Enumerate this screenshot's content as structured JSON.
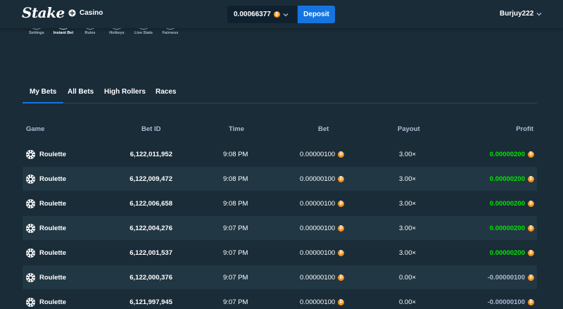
{
  "header": {
    "logo": "Stake",
    "casino_label": "Casino",
    "balance": "0.00066377",
    "deposit_label": "Deposit",
    "username": "Burjuy222"
  },
  "controls": [
    {
      "label": "Settings",
      "active": false
    },
    {
      "label": "Instant Bet",
      "active": true
    },
    {
      "label": "Rules",
      "active": false
    },
    {
      "label": "Hotkeys",
      "active": false
    },
    {
      "label": "Live Stats",
      "active": false
    },
    {
      "label": "Fairness",
      "active": false
    }
  ],
  "tabs": [
    "My Bets",
    "All Bets",
    "High Rollers",
    "Races"
  ],
  "table": {
    "columns": [
      "Game",
      "Bet ID",
      "Time",
      "Bet",
      "Payout",
      "Profit"
    ],
    "rows": [
      {
        "game": "Roulette",
        "bet_id": "6,122,011,952",
        "time": "9:08 PM",
        "bet": "0.00000100",
        "payout": "3.00×",
        "profit": "0.00000200",
        "positive": true
      },
      {
        "game": "Roulette",
        "bet_id": "6,122,009,472",
        "time": "9:08 PM",
        "bet": "0.00000100",
        "payout": "3.00×",
        "profit": "0.00000200",
        "positive": true
      },
      {
        "game": "Roulette",
        "bet_id": "6,122,006,658",
        "time": "9:08 PM",
        "bet": "0.00000100",
        "payout": "3.00×",
        "profit": "0.00000200",
        "positive": true
      },
      {
        "game": "Roulette",
        "bet_id": "6,122,004,276",
        "time": "9:07 PM",
        "bet": "0.00000100",
        "payout": "3.00×",
        "profit": "0.00000200",
        "positive": true
      },
      {
        "game": "Roulette",
        "bet_id": "6,122,001,537",
        "time": "9:07 PM",
        "bet": "0.00000100",
        "payout": "3.00×",
        "profit": "0.00000200",
        "positive": true
      },
      {
        "game": "Roulette",
        "bet_id": "6,122,000,376",
        "time": "9:07 PM",
        "bet": "0.00000100",
        "payout": "0.00×",
        "profit": "-0.00000100",
        "positive": false
      },
      {
        "game": "Roulette",
        "bet_id": "6,121,997,945",
        "time": "9:07 PM",
        "bet": "0.00000100",
        "payout": "0.00×",
        "profit": "-0.00000100",
        "positive": false
      }
    ]
  },
  "colors": {
    "background": "#1a2c38",
    "row_alt": "#213743",
    "accent": "#1475e1",
    "profit_positive": "#00e701",
    "bitcoin": "#f7931a"
  },
  "icons": {
    "currency": "bitcoin-icon",
    "game": "roulette-wheel-icon",
    "casino": "casino-chip-icon",
    "dropdown": "chevron-down-icon"
  }
}
